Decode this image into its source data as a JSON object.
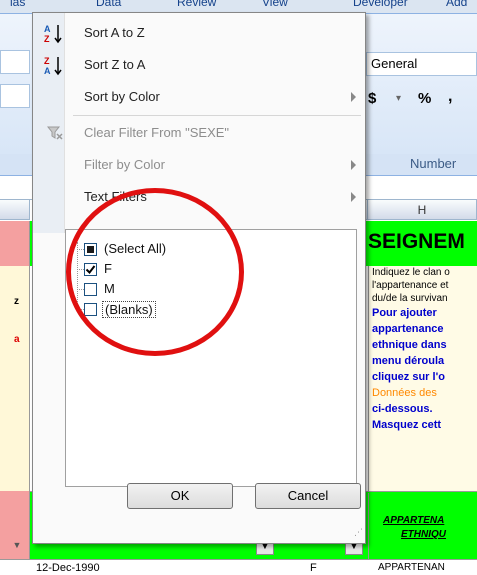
{
  "ribbon_tabs": [
    "ias",
    "Data",
    "Review",
    "View",
    "Developer",
    "Add"
  ],
  "ribbon": {
    "number_format": "General",
    "number_group_label": "Number",
    "currency_symbol": "$",
    "percent_symbol": "%",
    "comma_symbol": ","
  },
  "column_h": "H",
  "cells": {
    "header_text": "SEIGNEM",
    "instructions": [
      "Indiquez le clan o",
      "l'appartenance et",
      "du/de la survivan",
      "Pour ajouter",
      "appartenance",
      "ethnique dans",
      "menu déroula",
      "cliquez sur l'o",
      "Données des",
      "ci-dessous.",
      "Masquez cett"
    ],
    "col_header_1": "APPARTENA",
    "col_header_2": "ETHNIQU",
    "row_date": "12-Dec-1990",
    "row_sex": "F",
    "row_app": "APPARTENAN",
    "left_z": "z",
    "left_a": "a"
  },
  "menu": {
    "sort_az": "Sort A to Z",
    "sort_za": "Sort Z to A",
    "sort_by_color": "Sort by Color",
    "clear_filter": "Clear Filter From \"SEXE\"",
    "filter_by_color": "Filter by Color",
    "text_filters": "Text Filters",
    "list": [
      {
        "label": "(Select All)",
        "state": "partial"
      },
      {
        "label": "F",
        "state": "checked"
      },
      {
        "label": "M",
        "state": "unchecked"
      },
      {
        "label": "(Blanks)",
        "state": "unchecked"
      }
    ],
    "ok": "OK",
    "cancel": "Cancel"
  },
  "colors": {
    "accent_red": "#e01010",
    "sheet_green": "#00ff00",
    "header_pink": "#f4a0a0"
  }
}
